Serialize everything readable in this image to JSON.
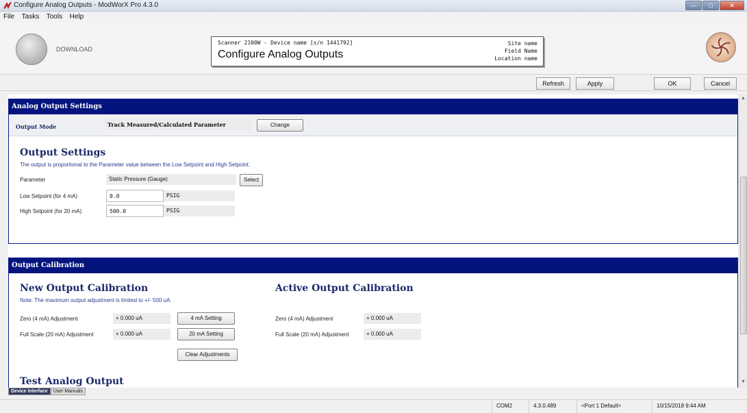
{
  "window": {
    "title": "Configure Analog Outputs - ModWorX Pro 4.3.0"
  },
  "menu": [
    "File",
    "Tasks",
    "Tools",
    "Help"
  ],
  "header": {
    "download_label": "DOWNLOAD",
    "device_line": "Scanner 2100W - Device name [s/n 1441792]",
    "page_title": "Configure Analog Outputs",
    "site_name": "Site name",
    "field_name": "Field Name",
    "location_name": "Location name"
  },
  "toolbar": {
    "refresh": "Refresh",
    "apply": "Apply",
    "ok": "OK",
    "cancel": "Cancel"
  },
  "analog_output_settings": {
    "header": "Analog Output Settings",
    "output_mode_label": "Output Mode",
    "output_mode_value": "Track Measured/Calculated Parameter",
    "change_button": "Change",
    "output_settings_title": "Output Settings",
    "description": "The output is proportional to the Parameter value between the Low Setpoint and High Setpoint.",
    "parameter_label": "Parameter",
    "parameter_value": "Static Pressure (Gauge)",
    "select_button": "Select",
    "low_setpoint_label": "Low Setpoint (for 4 mA)",
    "low_setpoint_value": "0.0",
    "low_setpoint_unit": "PSIG",
    "high_setpoint_label": "High Setpoint (for 20 mA)",
    "high_setpoint_value": "500.0",
    "high_setpoint_unit": "PSIG"
  },
  "output_calibration": {
    "header": "Output Calibration",
    "new_title": "New Output Calibration",
    "note": "Note: The maximum output adjustment is limited to +/- 500 uA.",
    "zero_label": "Zero (4 mA) Adjustment",
    "zero_value": "+ 0.000 uA",
    "zero_button": "4 mA Setting",
    "full_label": "Full Scale (20 mA) Adjustment",
    "full_value": "+ 0.000 uA",
    "full_button": "20 mA Setting",
    "clear_button": "Clear Adjustments",
    "active_title": "Active Output Calibration",
    "active_zero_label": "Zero (4 mA) Adjustment",
    "active_zero_value": "+ 0.000 uA",
    "active_full_label": "Full Scale (20 mA) Adjustment",
    "active_full_value": "+ 0.000 uA",
    "test_title": "Test Analog Output"
  },
  "tabs": [
    "Device Interface",
    "User Manuals"
  ],
  "status": {
    "port": "COM2",
    "version": "4.3.0.489",
    "port_default": "<Port 1 Default>",
    "datetime": "10/15/2018 9:44 AM"
  },
  "colors": {
    "section_header": "#04147e",
    "accent_text": "#1a2a6a"
  }
}
